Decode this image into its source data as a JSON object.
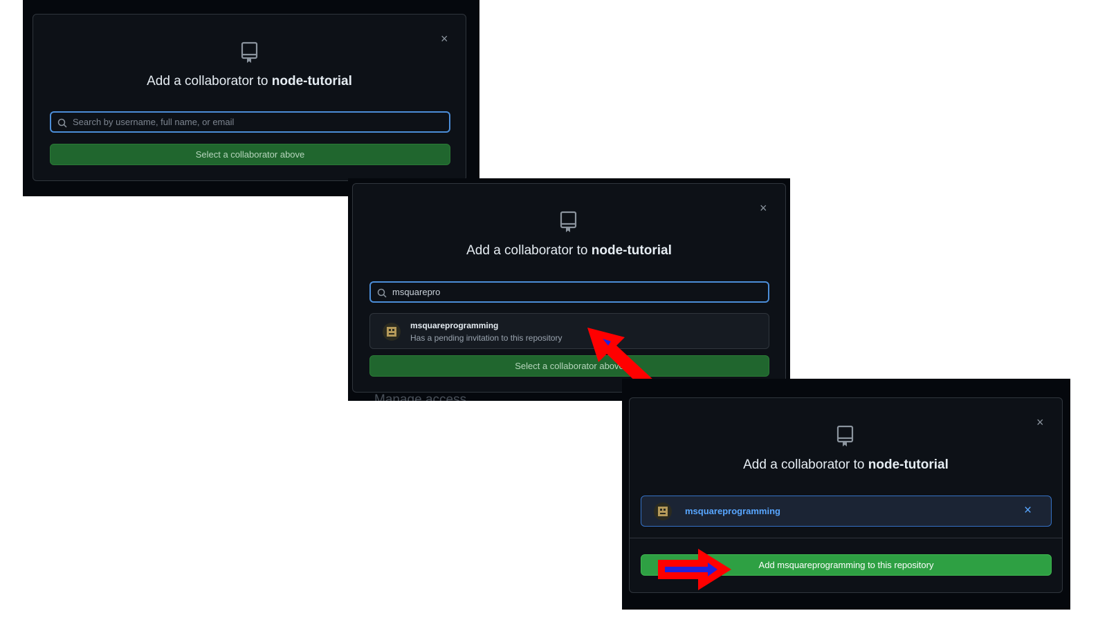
{
  "common": {
    "title_prefix": "Add a collaborator to",
    "repo_name": "node-tutorial",
    "close_symbol": "×"
  },
  "panel1": {
    "search_placeholder": "Search by username, full name, or email",
    "button_label": "Select a collaborator above"
  },
  "panel2": {
    "search_value": "msquarepro",
    "suggestion": {
      "username": "msquareprogramming",
      "status": "Has a pending invitation to this repository"
    },
    "button_label": "Select a collaborator above",
    "partial_background_text": "Manage access"
  },
  "panel3": {
    "selected_user": "msquareprogramming",
    "remove_symbol": "×",
    "button_label": "Add msquareprogramming to this repository"
  },
  "colors": {
    "annotation_arrow": "#ff0000",
    "arrow_inner": "#2222dd",
    "accent_blue": "#58a6ff",
    "button_green": "#2ea043"
  }
}
